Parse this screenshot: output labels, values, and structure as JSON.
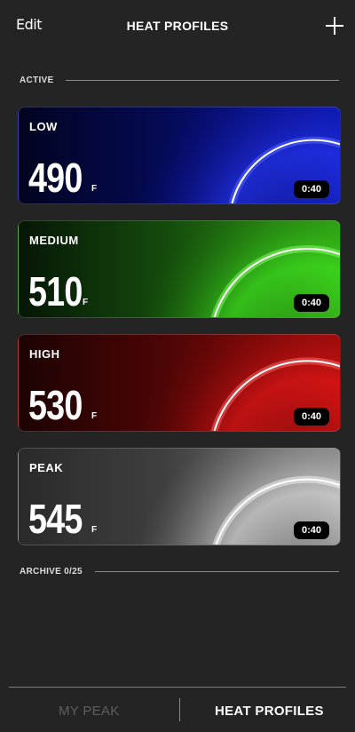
{
  "header": {
    "edit_label": "Edit",
    "title": "HEAT PROFILES"
  },
  "sections": {
    "active_label": "ACTIVE",
    "archive_label": "ARCHIVE 0/25"
  },
  "profiles": [
    {
      "name": "LOW",
      "temp": "490",
      "unit": "F",
      "time": "0:40",
      "color": "#1a2cff"
    },
    {
      "name": "MEDIUM",
      "temp": "510",
      "unit": "F",
      "time": "0:40",
      "color": "#44ff22"
    },
    {
      "name": "HIGH",
      "temp": "530",
      "unit": "F",
      "time": "0:40",
      "color": "#ff1a1a"
    },
    {
      "name": "PEAK",
      "temp": "545",
      "unit": "F",
      "time": "0:40",
      "color": "#ffffff"
    }
  ],
  "tabs": {
    "my_peak": "MY PEAK",
    "heat_profiles": "HEAT PROFILES"
  }
}
